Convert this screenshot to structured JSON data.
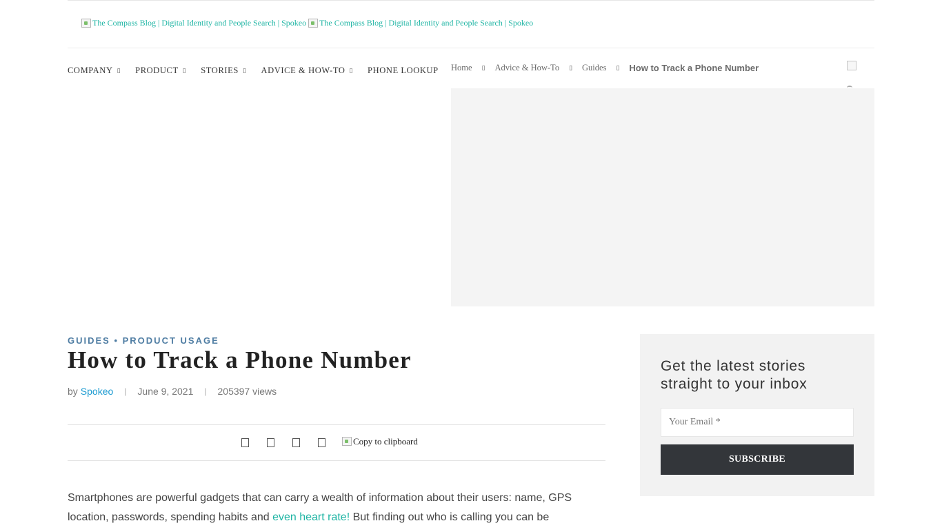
{
  "header": {
    "logo_alt": "The Compass Blog | Digital Identity and People Search | Spokeo",
    "logo_alt_2": "The Compass Blog | Digital Identity and People Search | Spokeo"
  },
  "nav": {
    "items": [
      {
        "label": "COMPANY"
      },
      {
        "label": "PRODUCT"
      },
      {
        "label": "STORIES"
      },
      {
        "label": "ADVICE & HOW-TO"
      },
      {
        "label": "PHONE LOOKUP"
      }
    ]
  },
  "breadcrumb": {
    "items": [
      "Home",
      "Advice & How-To",
      "Guides"
    ],
    "current": "How to Track a Phone Number"
  },
  "article": {
    "categories": "GUIDES • PRODUCT USAGE",
    "title": "How to Track a Phone Number",
    "by": "by",
    "author": "Spokeo",
    "date": "June 9, 2021",
    "views": "205397 views",
    "copy_label": "Copy to clipboard",
    "body_part1": "Smartphones are powerful gadgets that can carry a wealth of information about their users: name, GPS location, passwords, spending habits and ",
    "body_link": "even heart rate!",
    "body_part2": "  But finding out who is calling you can be"
  },
  "newsletter": {
    "title": "Get the latest stories straight to your inbox",
    "email_placeholder": "Your Email *",
    "subscribe_label": "SUBSCRIBE"
  },
  "colors": {
    "accent_teal": "#1fb5a4",
    "category_blue": "#4f7da3",
    "author_link": "#1d9bd1",
    "subscribe_bg": "#33363a"
  }
}
